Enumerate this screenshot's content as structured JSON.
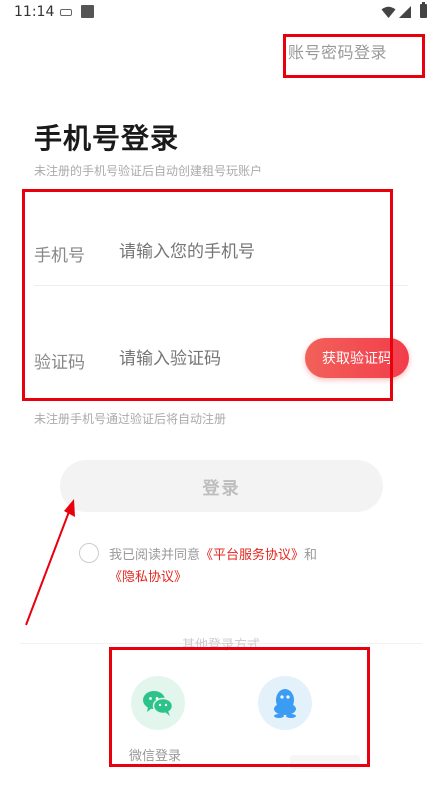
{
  "status_bar": {
    "time": "11:14"
  },
  "header": {
    "account_password_login": "账号密码登录"
  },
  "page": {
    "title": "手机号登录",
    "subtitle": "未注册的手机号验证后自动创建租号玩账户"
  },
  "form": {
    "phone_label": "手机号",
    "phone_placeholder": "请输入您的手机号",
    "code_label": "验证码",
    "code_placeholder": "请输入验证码",
    "get_code_button": "获取验证码",
    "note": "未注册手机号通过验证后将自动注册",
    "login_button": "登录"
  },
  "agreement": {
    "prefix": "我已阅读并同意",
    "platform_agreement": "《平台服务协议》",
    "and": "和",
    "privacy_agreement": "《隐私协议》"
  },
  "other_login": {
    "label": "其他登录方式",
    "wechat_label": "微信登录"
  },
  "colors": {
    "accent_red": "#f23d4b",
    "annotation_red": "#e8000d",
    "wechat_green": "#2bc38a",
    "qq_blue": "#3a9cf2"
  }
}
